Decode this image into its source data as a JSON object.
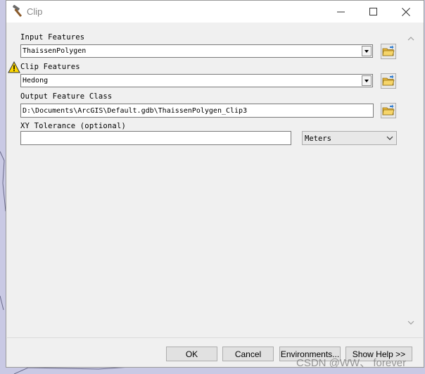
{
  "window": {
    "title": "Clip",
    "controls": {
      "minimize": "—",
      "maximize": "☐",
      "close": "✕"
    }
  },
  "form": {
    "input_features": {
      "label": "Input Features",
      "value": "ThaissenPolygen"
    },
    "clip_features": {
      "label": "Clip Features",
      "value": "Hedong",
      "warning": true
    },
    "output_feature_class": {
      "label": "Output Feature Class",
      "value": "D:\\Documents\\ArcGIS\\Default.gdb\\ThaissenPolygen_Clip3"
    },
    "xy_tolerance": {
      "label": "XY Tolerance (optional)",
      "value": "",
      "unit": "Meters"
    }
  },
  "buttons": {
    "ok": "OK",
    "cancel": "Cancel",
    "environments": "Environments...",
    "show_help": "Show Help >>"
  },
  "watermark": "CSDN @WW、 forever",
  "icons": {
    "title": "hammer-icon",
    "warning": "warning-triangle-icon",
    "browse": "open-folder-icon"
  },
  "colors": {
    "dialog_bg": "#f0f0f0",
    "map_bg": "#c9c9e4",
    "folder_yellow": "#f2c744",
    "warning_yellow": "#ffd800"
  }
}
